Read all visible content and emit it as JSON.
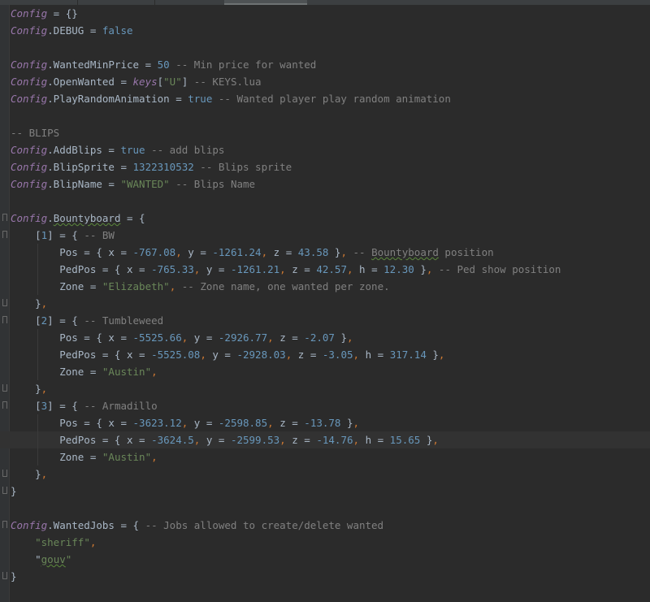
{
  "editor": {
    "lines": [
      [
        {
          "t": "Config",
          "c": "cfg"
        },
        {
          "t": " = {}"
        }
      ],
      [
        {
          "t": "Config",
          "c": "cfg"
        },
        {
          "t": ".DEBUG = "
        },
        {
          "t": "false",
          "c": "bool"
        }
      ],
      [],
      [
        {
          "t": "Config",
          "c": "cfg"
        },
        {
          "t": ".WantedMinPrice = "
        },
        {
          "t": "50",
          "c": "num"
        },
        {
          "t": " -- Min price for wanted",
          "c": "cmt"
        }
      ],
      [
        {
          "t": "Config",
          "c": "cfg"
        },
        {
          "t": ".OpenWanted = "
        },
        {
          "t": "keys",
          "c": "cfg"
        },
        {
          "t": "["
        },
        {
          "t": "\"U\"",
          "c": "str"
        },
        {
          "t": "]"
        },
        {
          "t": " -- KEYS.lua",
          "c": "cmt"
        }
      ],
      [
        {
          "t": "Config",
          "c": "cfg"
        },
        {
          "t": ".PlayRandomAnimation = "
        },
        {
          "t": "true",
          "c": "bool"
        },
        {
          "t": " -- Wanted player play random animation",
          "c": "cmt"
        }
      ],
      [],
      [
        {
          "t": "-- BLIPS",
          "c": "cmt"
        }
      ],
      [
        {
          "t": "Config",
          "c": "cfg"
        },
        {
          "t": ".AddBlips = "
        },
        {
          "t": "true",
          "c": "bool"
        },
        {
          "t": " -- add blips",
          "c": "cmt"
        }
      ],
      [
        {
          "t": "Config",
          "c": "cfg"
        },
        {
          "t": ".BlipSprite = "
        },
        {
          "t": "1322310532",
          "c": "num"
        },
        {
          "t": " -- Blips sprite",
          "c": "cmt"
        }
      ],
      [
        {
          "t": "Config",
          "c": "cfg"
        },
        {
          "t": ".BlipName = "
        },
        {
          "t": "\"WANTED\"",
          "c": "str"
        },
        {
          "t": " -- Blips Name",
          "c": "cmt"
        }
      ],
      [],
      [
        {
          "t": "Config",
          "c": "cfg"
        },
        {
          "t": "."
        },
        {
          "t": "Bountyboard",
          "c": "wavy"
        },
        {
          "t": " = {"
        }
      ],
      [
        {
          "t": "    ["
        },
        {
          "t": "1",
          "c": "num"
        },
        {
          "t": "] = { "
        },
        {
          "t": "-- BW",
          "c": "cmt"
        }
      ],
      [
        {
          "t": "        Pos = { x = "
        },
        {
          "t": "-767.08",
          "c": "num"
        },
        {
          "t": ", ",
          "c": "kw"
        },
        {
          "t": "y = "
        },
        {
          "t": "-1261.24",
          "c": "num"
        },
        {
          "t": ", ",
          "c": "kw"
        },
        {
          "t": "z = "
        },
        {
          "t": "43.58",
          "c": "num"
        },
        {
          "t": " }"
        },
        {
          "t": ",",
          "c": "kw"
        },
        {
          "t": " -- ",
          "c": "cmt"
        },
        {
          "t": "Bountyboard",
          "c": "cmt wavy"
        },
        {
          "t": " position",
          "c": "cmt"
        }
      ],
      [
        {
          "t": "        PedPos = { x = "
        },
        {
          "t": "-765.33",
          "c": "num"
        },
        {
          "t": ", ",
          "c": "kw"
        },
        {
          "t": "y = "
        },
        {
          "t": "-1261.21",
          "c": "num"
        },
        {
          "t": ", ",
          "c": "kw"
        },
        {
          "t": "z = "
        },
        {
          "t": "42.57",
          "c": "num"
        },
        {
          "t": ", ",
          "c": "kw"
        },
        {
          "t": "h = "
        },
        {
          "t": "12.30",
          "c": "num"
        },
        {
          "t": " }"
        },
        {
          "t": ",",
          "c": "kw"
        },
        {
          "t": " -- Ped show position",
          "c": "cmt"
        }
      ],
      [
        {
          "t": "        Zone = "
        },
        {
          "t": "\"Elizabeth\"",
          "c": "str"
        },
        {
          "t": ",",
          "c": "kw"
        },
        {
          "t": " -- Zone name, one wanted per zone.",
          "c": "cmt"
        }
      ],
      [
        {
          "t": "    }"
        },
        {
          "t": ",",
          "c": "kw"
        }
      ],
      [
        {
          "t": "    ["
        },
        {
          "t": "2",
          "c": "num"
        },
        {
          "t": "] = { "
        },
        {
          "t": "-- Tumbleweed",
          "c": "cmt"
        }
      ],
      [
        {
          "t": "        Pos = { x = "
        },
        {
          "t": "-5525.66",
          "c": "num"
        },
        {
          "t": ", ",
          "c": "kw"
        },
        {
          "t": "y = "
        },
        {
          "t": "-2926.77",
          "c": "num"
        },
        {
          "t": ", ",
          "c": "kw"
        },
        {
          "t": "z = "
        },
        {
          "t": "-2.07",
          "c": "num"
        },
        {
          "t": " }"
        },
        {
          "t": ",",
          "c": "kw"
        }
      ],
      [
        {
          "t": "        PedPos = { x = "
        },
        {
          "t": "-5525.08",
          "c": "num"
        },
        {
          "t": ", ",
          "c": "kw"
        },
        {
          "t": "y = "
        },
        {
          "t": "-2928.03",
          "c": "num"
        },
        {
          "t": ", ",
          "c": "kw"
        },
        {
          "t": "z = "
        },
        {
          "t": "-3.05",
          "c": "num"
        },
        {
          "t": ", ",
          "c": "kw"
        },
        {
          "t": "h = "
        },
        {
          "t": "317.14",
          "c": "num"
        },
        {
          "t": " }"
        },
        {
          "t": ",",
          "c": "kw"
        }
      ],
      [
        {
          "t": "        Zone = "
        },
        {
          "t": "\"Austin\"",
          "c": "str"
        },
        {
          "t": ",",
          "c": "kw"
        }
      ],
      [
        {
          "t": "    }"
        },
        {
          "t": ",",
          "c": "kw"
        }
      ],
      [
        {
          "t": "    ["
        },
        {
          "t": "3",
          "c": "num"
        },
        {
          "t": "] = { "
        },
        {
          "t": "-- Armadillo",
          "c": "cmt"
        }
      ],
      [
        {
          "t": "        Pos = { x = "
        },
        {
          "t": "-3623.12",
          "c": "num"
        },
        {
          "t": ", ",
          "c": "kw"
        },
        {
          "t": "y = "
        },
        {
          "t": "-2598.85",
          "c": "num"
        },
        {
          "t": ", ",
          "c": "kw"
        },
        {
          "t": "z = "
        },
        {
          "t": "-13.78",
          "c": "num"
        },
        {
          "t": " }"
        },
        {
          "t": ",",
          "c": "kw"
        }
      ],
      [
        {
          "t": "        PedPos = { x = "
        },
        {
          "t": "-3624.5",
          "c": "num"
        },
        {
          "t": ", ",
          "c": "kw"
        },
        {
          "t": "y = "
        },
        {
          "t": "-2599.53",
          "c": "num"
        },
        {
          "t": ", ",
          "c": "kw"
        },
        {
          "t": "z = "
        },
        {
          "t": "-14.76",
          "c": "num"
        },
        {
          "t": ", ",
          "c": "kw"
        },
        {
          "t": "h = "
        },
        {
          "t": "15.65",
          "c": "num"
        },
        {
          "t": " }"
        },
        {
          "t": ",",
          "c": "kw"
        }
      ],
      [
        {
          "t": "        Zone = "
        },
        {
          "t": "\"Austin\"",
          "c": "str"
        },
        {
          "t": ",",
          "c": "kw"
        }
      ],
      [
        {
          "t": "    }"
        },
        {
          "t": ",",
          "c": "kw"
        }
      ],
      [
        {
          "t": "}"
        }
      ],
      [],
      [
        {
          "t": "Config",
          "c": "cfg"
        },
        {
          "t": ".WantedJobs = { "
        },
        {
          "t": "-- Jobs allowed to create/delete wanted",
          "c": "cmt"
        }
      ],
      [
        {
          "t": "    "
        },
        {
          "t": "\"sheriff\"",
          "c": "str"
        },
        {
          "t": ",",
          "c": "kw"
        }
      ],
      [
        {
          "t": "    \""
        },
        {
          "t": "gouv",
          "c": "str wavy"
        },
        {
          "t": "\"",
          "c": "str"
        }
      ],
      [
        {
          "t": "}"
        }
      ]
    ],
    "current_line": 25,
    "fold_open": [
      12,
      13,
      18,
      23,
      30
    ],
    "fold_close": [
      17,
      22,
      27,
      28,
      33
    ],
    "colors": {
      "background": "#2b2b2b",
      "current_line": "#323232",
      "config": "#9876aa",
      "number": "#6897bb",
      "string": "#6a8759",
      "comment": "#808080",
      "punct": "#cc7832"
    }
  }
}
